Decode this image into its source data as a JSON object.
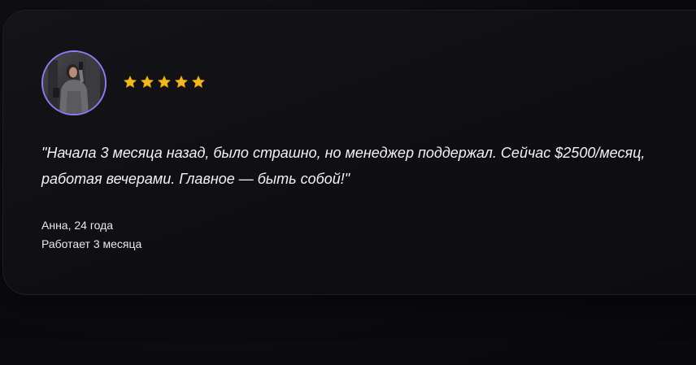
{
  "testimonial": {
    "rating": 5,
    "rating_max": 5,
    "quote": "\"Начала 3 месяца назад, было страшно, но менеджер поддержал. Сейчас $2500/месяц, работая вечерами. Главное — быть собой!\"",
    "author_name": "Анна, 24 года",
    "author_meta": "Работает 3 месяца"
  },
  "colors": {
    "star": "#f2b822",
    "avatar_ring": "#8a7ef0",
    "card_background": "#121216",
    "text": "#f2f2f4"
  },
  "icons": {
    "star": "star-icon",
    "avatar": "avatar"
  }
}
